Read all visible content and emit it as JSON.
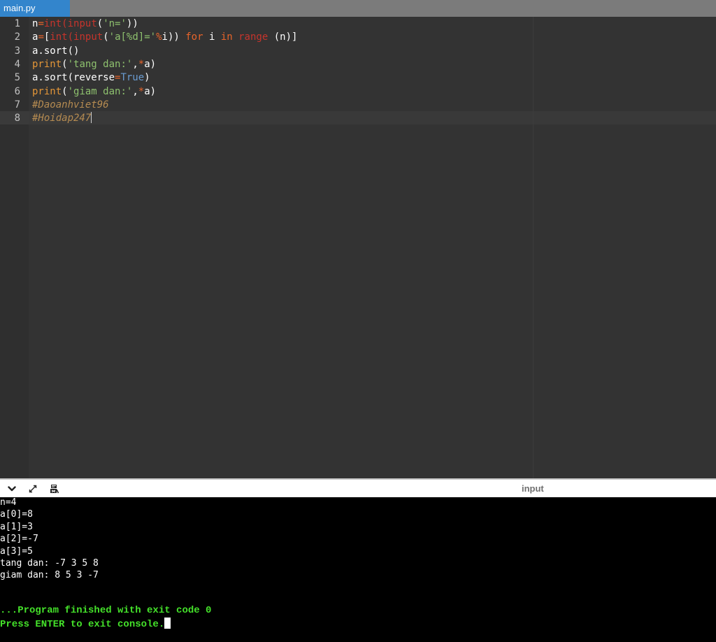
{
  "tab": {
    "label": "main.py"
  },
  "editor": {
    "lines": [
      {
        "num": "1",
        "tokens": [
          {
            "t": "n",
            "c": "plain"
          },
          {
            "t": "=",
            "c": "kw"
          },
          {
            "t": "int",
            "c": "fn"
          },
          {
            "t": "(",
            "c": "fn"
          },
          {
            "t": "input",
            "c": "fn"
          },
          {
            "t": "(",
            "c": "plain"
          },
          {
            "t": "'n='",
            "c": "str"
          },
          {
            "t": "))",
            "c": "plain"
          }
        ]
      },
      {
        "num": "2",
        "tokens": [
          {
            "t": "a",
            "c": "plain"
          },
          {
            "t": "=",
            "c": "kw"
          },
          {
            "t": "[",
            "c": "plain"
          },
          {
            "t": "int",
            "c": "fn"
          },
          {
            "t": "(",
            "c": "fn"
          },
          {
            "t": "input",
            "c": "fn"
          },
          {
            "t": "(",
            "c": "plain"
          },
          {
            "t": "'a[%d]='",
            "c": "str"
          },
          {
            "t": "%",
            "c": "kw"
          },
          {
            "t": "i)) ",
            "c": "plain"
          },
          {
            "t": "for",
            "c": "kw"
          },
          {
            "t": " i ",
            "c": "plain"
          },
          {
            "t": "in",
            "c": "kw"
          },
          {
            "t": " ",
            "c": "plain"
          },
          {
            "t": "range",
            "c": "fn"
          },
          {
            "t": " (n)]",
            "c": "plain"
          }
        ]
      },
      {
        "num": "3",
        "tokens": [
          {
            "t": "a.sort()",
            "c": "plain"
          }
        ]
      },
      {
        "num": "4",
        "tokens": [
          {
            "t": "print",
            "c": "bi"
          },
          {
            "t": "(",
            "c": "plain"
          },
          {
            "t": "'tang dan:'",
            "c": "str"
          },
          {
            "t": ",",
            "c": "plain"
          },
          {
            "t": "*",
            "c": "kw"
          },
          {
            "t": "a)",
            "c": "plain"
          }
        ]
      },
      {
        "num": "5",
        "tokens": [
          {
            "t": "a.sort(reverse",
            "c": "plain"
          },
          {
            "t": "=",
            "c": "kw"
          },
          {
            "t": "True",
            "c": "num"
          },
          {
            "t": ")",
            "c": "plain"
          }
        ]
      },
      {
        "num": "6",
        "tokens": [
          {
            "t": "print",
            "c": "bi"
          },
          {
            "t": "(",
            "c": "plain"
          },
          {
            "t": "'giam dan:'",
            "c": "str"
          },
          {
            "t": ",",
            "c": "plain"
          },
          {
            "t": "*",
            "c": "kw"
          },
          {
            "t": "a)",
            "c": "plain"
          }
        ]
      },
      {
        "num": "7",
        "tokens": [
          {
            "t": "#Daoanhviet96",
            "c": "cmt"
          }
        ]
      },
      {
        "num": "8",
        "tokens": [
          {
            "t": "#Hoidap247",
            "c": "cmt"
          }
        ]
      }
    ]
  },
  "console_toolbar": {
    "collapse_icon": "chevron-down-icon",
    "expand_icon": "expand-arrows-icon",
    "clear_icon": "clear-console-icon",
    "label": "input"
  },
  "console": {
    "lines": [
      "n=4",
      "a[0]=8",
      "a[1]=3",
      "a[2]=-7",
      "a[3]=5",
      "tang dan: -7 3 5 8",
      "giam dan: 8 5 3 -7"
    ],
    "status_line_1": "...Program finished with exit code 0",
    "status_line_2": "Press ENTER to exit console."
  },
  "colors": {
    "tab_active": "#3385cc",
    "editor_bg": "#333333",
    "console_bg": "#000000",
    "console_status": "#44e12a"
  }
}
